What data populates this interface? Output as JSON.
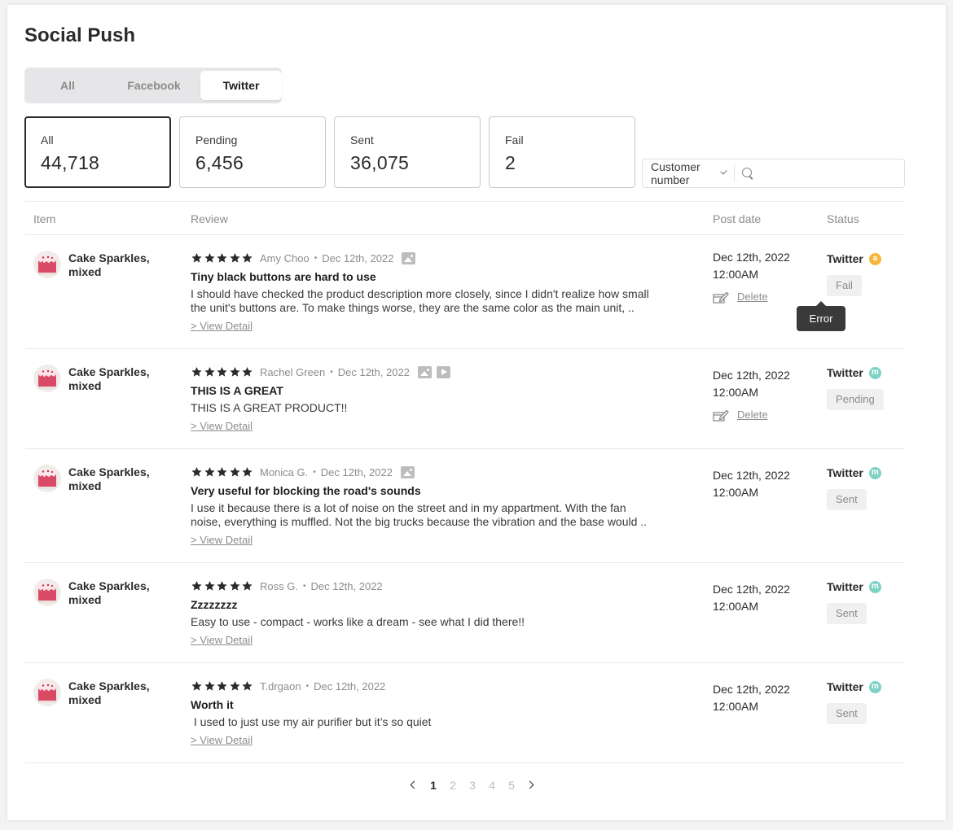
{
  "page": {
    "title": "Social Push"
  },
  "tabs": [
    {
      "label": "All",
      "active": false
    },
    {
      "label": "Facebook",
      "active": false
    },
    {
      "label": "Twitter",
      "active": true
    }
  ],
  "stats": [
    {
      "label": "All",
      "value": "44,718",
      "active": true
    },
    {
      "label": "Pending",
      "value": "6,456",
      "active": false
    },
    {
      "label": "Sent",
      "value": "36,075",
      "active": false
    },
    {
      "label": "Fail",
      "value": "2",
      "active": false
    }
  ],
  "search": {
    "filter": "Customer number",
    "value": "",
    "placeholder": ""
  },
  "columns": {
    "item": "Item",
    "review": "Review",
    "post_date": "Post date",
    "status": "Status"
  },
  "rows": [
    {
      "item": "Cake Sparkles, mixed",
      "rating": 5,
      "author": "Amy Choo",
      "date": "Dec 12th, 2022",
      "media": [
        "image-icon"
      ],
      "title": "Tiny black buttons are hard to use",
      "body": "I should have checked the product description more closely, since I didn't realize how small\nthe unit's buttons are. To make things worse, they are the same color as the main unit, ..",
      "view_detail": "> View Detail",
      "post_date": "Dec 12th, 2022",
      "post_time": "12:00AM",
      "delete_label": "Delete",
      "channel": "Twitter",
      "badge": "a",
      "badge_color": "#f4b63d",
      "status": "Fail"
    },
    {
      "item": "Cake Sparkles, mixed",
      "rating": 5,
      "author": "Rachel Green",
      "date": "Dec 12th, 2022",
      "media": [
        "image-icon",
        "video-icon"
      ],
      "title": "THIS IS A GREAT",
      "body": "THIS IS A GREAT PRODUCT!!",
      "view_detail": "> View Detail",
      "post_date": "Dec 12th, 2022",
      "post_time": "12:00AM",
      "delete_label": "Delete",
      "channel": "Twitter",
      "badge": "m",
      "badge_color": "#7fd1c5",
      "status": "Pending"
    },
    {
      "item": "Cake Sparkles, mixed",
      "rating": 5,
      "author": "Monica G.",
      "date": "Dec 12th, 2022",
      "media": [
        "image-icon"
      ],
      "title": "Very useful for blocking the road's sounds",
      "body": "I use it because there is a lot of noise on the street and in my appartment. With the fan\nnoise, everything is muffled. Not the big trucks because the vibration and the base would ..",
      "view_detail": "> View Detail",
      "post_date": "Dec 12th, 2022",
      "post_time": "12:00AM",
      "channel": "Twitter",
      "badge": "m",
      "badge_color": "#7fd1c5",
      "status": "Sent"
    },
    {
      "item": "Cake Sparkles, mixed",
      "rating": 5,
      "author": "Ross G.",
      "date": "Dec 12th, 2022",
      "media": [],
      "title": "Zzzzzzzz",
      "body": "Easy to use - compact - works like a dream - see what I did there!!",
      "view_detail": "> View Detail",
      "post_date": "Dec 12th, 2022",
      "post_time": "12:00AM",
      "channel": "Twitter",
      "badge": "m",
      "badge_color": "#7fd1c5",
      "status": "Sent"
    },
    {
      "item": "Cake Sparkles, mixed",
      "rating": 5,
      "author": "T.drgaon",
      "date": "Dec 12th, 2022",
      "media": [],
      "title": "Worth it",
      "body": " I used to just use my air purifier but it’s so quiet",
      "view_detail": "> View Detail",
      "post_date": "Dec 12th, 2022",
      "post_time": "12:00AM",
      "channel": "Twitter",
      "badge": "m",
      "badge_color": "#7fd1c5",
      "status": "Sent"
    }
  ],
  "tooltip": {
    "text": "Error"
  },
  "pagination": {
    "pages": [
      "1",
      "2",
      "3",
      "4",
      "5"
    ],
    "current": "1"
  }
}
